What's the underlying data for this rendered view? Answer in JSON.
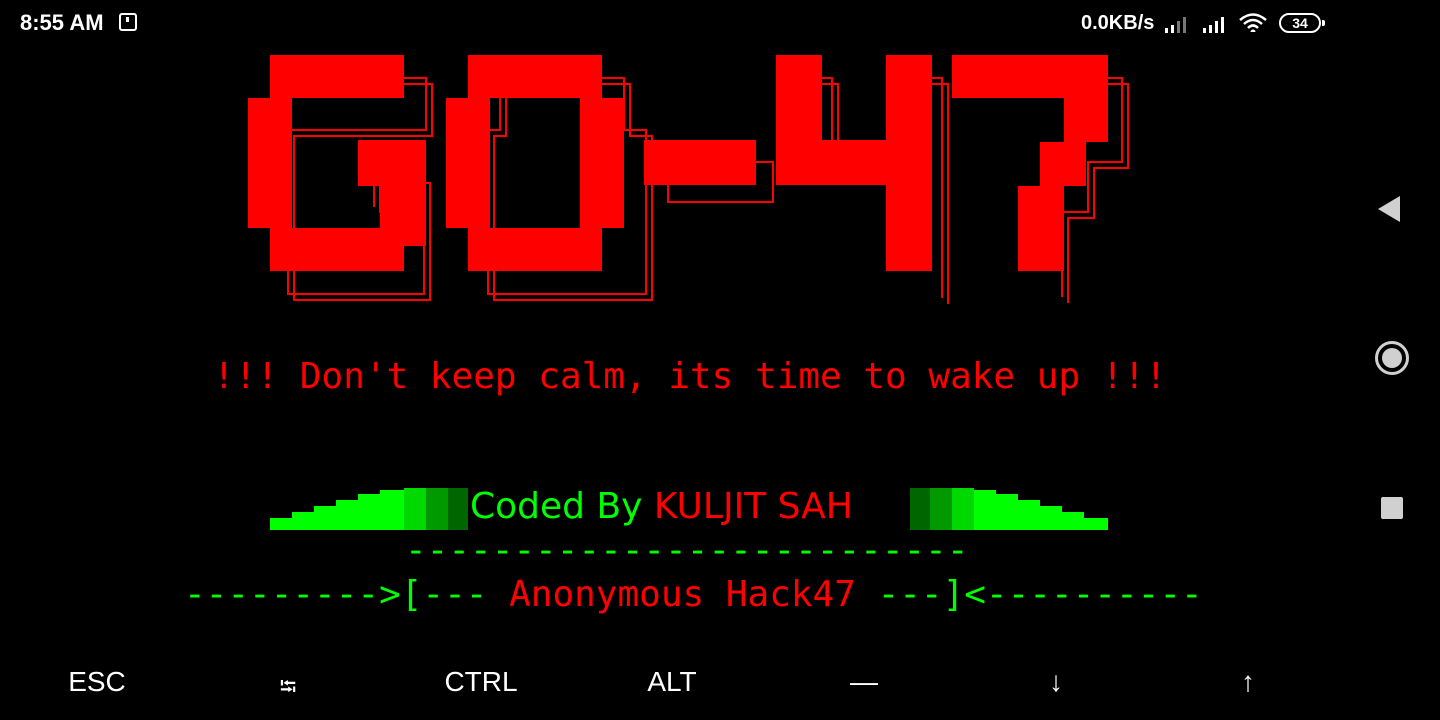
{
  "status_bar": {
    "time": "8:55 AM",
    "net_speed": "0.0KB/s",
    "battery": "34"
  },
  "banner": {
    "logo_text": "GO-47",
    "slogan": "!!! Don't keep calm, its time to wake up !!!",
    "credit_prefix": "Coded By ",
    "credit_name": "KULJIT SAH",
    "dash_line": "--------------------------",
    "arrow_left": "--------->[--- ",
    "team_name": "Anonymous Hack47",
    "arrow_right": " ---]<----------"
  },
  "extra_keys": {
    "esc": "ESC",
    "tab": "⭾",
    "ctrl": "CTRL",
    "alt": "ALT",
    "dash": "—",
    "down": "↓",
    "up": "↑"
  },
  "colors": {
    "logo": "#ff0000",
    "accent_green": "#00ff00",
    "text_red": "#ff0000",
    "background": "#000000"
  }
}
